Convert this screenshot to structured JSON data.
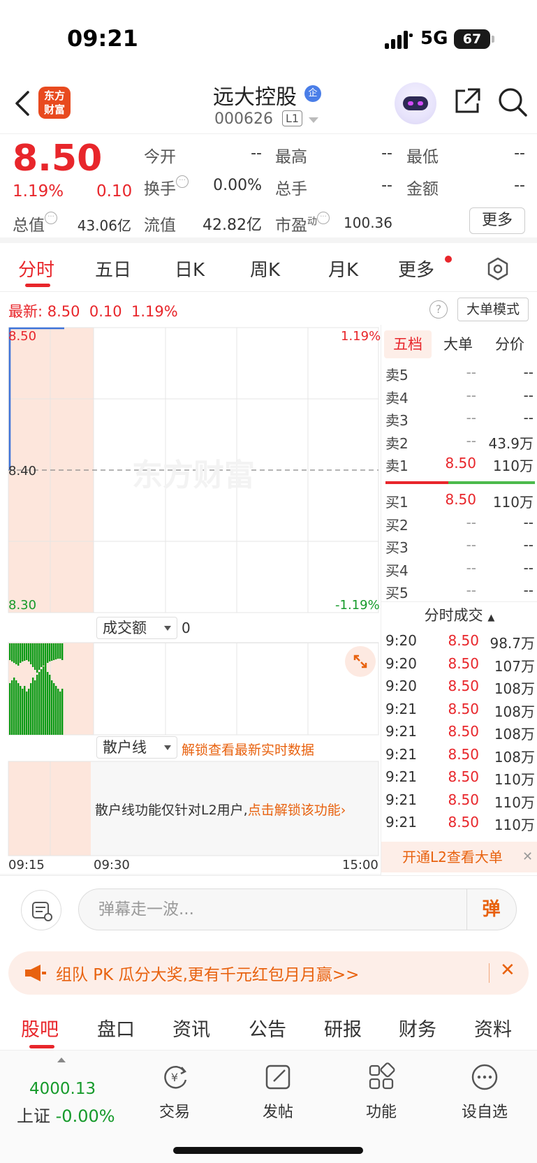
{
  "status_bar": {
    "time": "09:21",
    "network": "5G",
    "battery": "67"
  },
  "header": {
    "logo_line1": "东方",
    "logo_line2": "财富",
    "stock_name": "远大控股",
    "badge": "企",
    "stock_code": "000626",
    "level": "L1"
  },
  "quote": {
    "price": "8.50",
    "change_pct": "1.19%",
    "change": "0.10",
    "fields": {
      "open_label": "今开",
      "open": "--",
      "high_label": "最高",
      "high": "--",
      "low_label": "最低",
      "low": "--",
      "turnover_label": "换手",
      "turnover": "0.00%",
      "volume_label": "总手",
      "volume": "--",
      "amount_label": "金额",
      "amount": "--",
      "mktcap_label": "总值",
      "mktcap": "43.06亿",
      "float_label": "流值",
      "float": "42.82亿",
      "pe_label": "市盈",
      "pe_sup": "动",
      "pe": "100.36"
    },
    "more_label": "更多"
  },
  "kline_tabs": {
    "items": [
      "分时",
      "五日",
      "日K",
      "周K",
      "月K",
      "更多"
    ],
    "active": 0
  },
  "latest": {
    "label": "最新:",
    "price": "8.50",
    "change": "0.10",
    "pct": "1.19%"
  },
  "big_order_mode": "大单模式",
  "chart": {
    "price_top": "8.50",
    "price_mid": "8.40",
    "price_bottom": "8.30",
    "pct_top": "1.19%",
    "pct_bottom": "-1.19%",
    "watermark": "东方财富",
    "volume_selector": "成交额",
    "volume_value": "0",
    "retail_selector": "散户线",
    "retail_unlock": "解锁查看最新实时数据",
    "retail_msg": "散户线功能仅针对L2用户,",
    "retail_link": "点击解锁该功能",
    "time_start": "09:15",
    "time_mid": "09:30",
    "time_end": "15:00"
  },
  "chart_data": {
    "type": "line",
    "x": [
      "09:15",
      "09:20",
      "09:21"
    ],
    "series": [
      {
        "values": [
          8.5,
          8.5,
          8.5
        ]
      }
    ],
    "ylim": [
      8.3,
      8.5
    ],
    "reference": 8.4,
    "xlabel": "",
    "ylabel": ""
  },
  "order_book": {
    "tabs": [
      "五档",
      "大单",
      "分价"
    ],
    "active_tab": 0,
    "asks": [
      {
        "label": "卖5",
        "price": "--",
        "vol": "--"
      },
      {
        "label": "卖4",
        "price": "--",
        "vol": "--"
      },
      {
        "label": "卖3",
        "price": "--",
        "vol": "--"
      },
      {
        "label": "卖2",
        "price": "--",
        "vol": "43.9万"
      },
      {
        "label": "卖1",
        "price": "8.50",
        "vol": "110万"
      }
    ],
    "bids": [
      {
        "label": "买1",
        "price": "8.50",
        "vol": "110万"
      },
      {
        "label": "买2",
        "price": "--",
        "vol": "--"
      },
      {
        "label": "买3",
        "price": "--",
        "vol": "--"
      },
      {
        "label": "买4",
        "price": "--",
        "vol": "--"
      },
      {
        "label": "买5",
        "price": "--",
        "vol": "--"
      }
    ],
    "ticks_title": "分时成交",
    "ticks": [
      {
        "time": "9:20",
        "price": "8.50",
        "vol": "98.7万"
      },
      {
        "time": "9:20",
        "price": "8.50",
        "vol": "107万"
      },
      {
        "time": "9:20",
        "price": "8.50",
        "vol": "108万"
      },
      {
        "time": "9:21",
        "price": "8.50",
        "vol": "108万"
      },
      {
        "time": "9:21",
        "price": "8.50",
        "vol": "108万"
      },
      {
        "time": "9:21",
        "price": "8.50",
        "vol": "108万"
      },
      {
        "time": "9:21",
        "price": "8.50",
        "vol": "110万"
      },
      {
        "time": "9:21",
        "price": "8.50",
        "vol": "110万"
      },
      {
        "time": "9:21",
        "price": "8.50",
        "vol": "110万"
      }
    ],
    "l2_banner": "开通L2查看大单"
  },
  "danmu": {
    "placeholder": "弹幕走一波...",
    "send": "弹"
  },
  "promo": {
    "text": "组队 PK 瓜分大奖,更有千元红包月月赢>>"
  },
  "bottom_tabs": {
    "items": [
      "股吧",
      "盘口",
      "资讯",
      "公告",
      "研报",
      "财务",
      "资料"
    ],
    "active": 0
  },
  "nav": {
    "index_value": "4000.13",
    "index_name": "上证",
    "index_change": "-0.00%",
    "items": [
      "交易",
      "发帖",
      "功能",
      "设自选"
    ]
  },
  "colors": {
    "up": "#e8262b",
    "down": "#169a2b",
    "accent": "#e8620f"
  }
}
